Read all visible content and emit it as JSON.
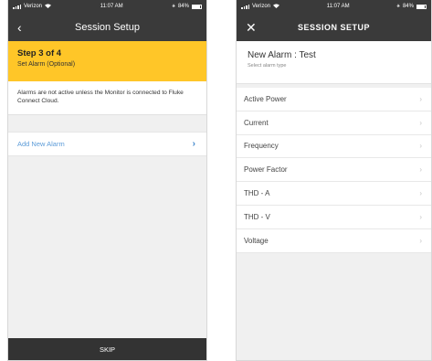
{
  "left_screen": {
    "status": {
      "carrier": "Verizon",
      "time": "11:07 AM",
      "battery": "84%"
    },
    "nav": {
      "back_icon": "chevron-left-icon",
      "back_glyph": "‹",
      "title": "Session Setup"
    },
    "step": {
      "title": "Step 3 of 4",
      "subtitle": "Set Alarm (Optional)"
    },
    "notice": "Alarms are not active unless the Monitor is connected to Fluke Connect Cloud.",
    "add_alarm": {
      "label": "Add New Alarm",
      "chevron": "›"
    },
    "skip_label": "SKIP"
  },
  "right_screen": {
    "status": {
      "carrier": "Verizon",
      "time": "11:07 AM",
      "battery": "84%"
    },
    "nav": {
      "close_icon": "close-icon",
      "close_glyph": "✕",
      "title": "SESSION SETUP"
    },
    "header": {
      "title": "New Alarm : Test",
      "subtitle": "Select alarm type"
    },
    "alarm_types": [
      {
        "label": "Active Power",
        "chevron": "›"
      },
      {
        "label": "Current",
        "chevron": "›"
      },
      {
        "label": "Frequency",
        "chevron": "›"
      },
      {
        "label": "Power Factor",
        "chevron": "›"
      },
      {
        "label": "THD - A",
        "chevron": "›"
      },
      {
        "label": "THD - V",
        "chevron": "›"
      },
      {
        "label": "Voltage",
        "chevron": "›"
      }
    ]
  },
  "colors": {
    "navbar": "#3a3a3a",
    "accent_yellow": "#ffc628",
    "link_blue": "#5b9bd8",
    "background": "#f0f0f0"
  }
}
